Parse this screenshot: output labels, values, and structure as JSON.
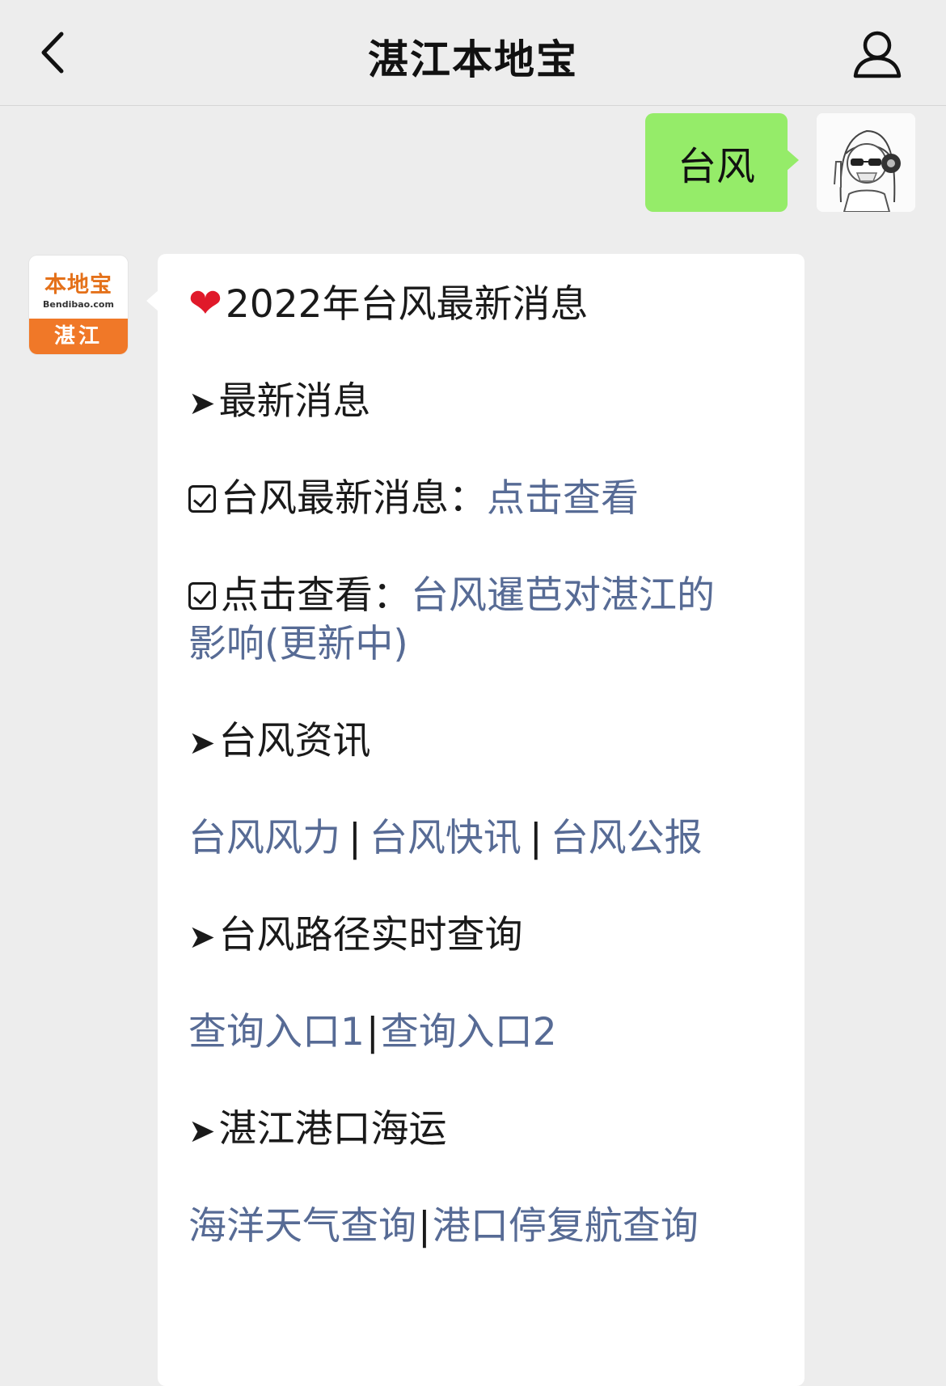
{
  "nav": {
    "title": "湛江本地宝"
  },
  "outgoing": {
    "text": "台风"
  },
  "bot": {
    "logo_text": "本地宝",
    "logo_url": "Bendibao.com",
    "city": "湛江"
  },
  "message": {
    "title": "2022年台风最新消息",
    "section_latest": "最新消息",
    "latest_label": "台风最新消息：",
    "latest_link": "点击查看",
    "view_label": "点击查看：",
    "view_link_line1": "台风暹芭对湛江的",
    "view_link_line2": "影响(更新中)",
    "section_info": "台风资讯",
    "info_links": [
      "台风风力",
      "台风快讯",
      "台风公报"
    ],
    "section_path": "台风路径实时查询",
    "path_links": [
      "查询入口1",
      "查询入口2"
    ],
    "section_port": "湛江港口海运",
    "port_links": [
      "海洋天气查询",
      "港口停复航查询"
    ],
    "separator": "|"
  }
}
